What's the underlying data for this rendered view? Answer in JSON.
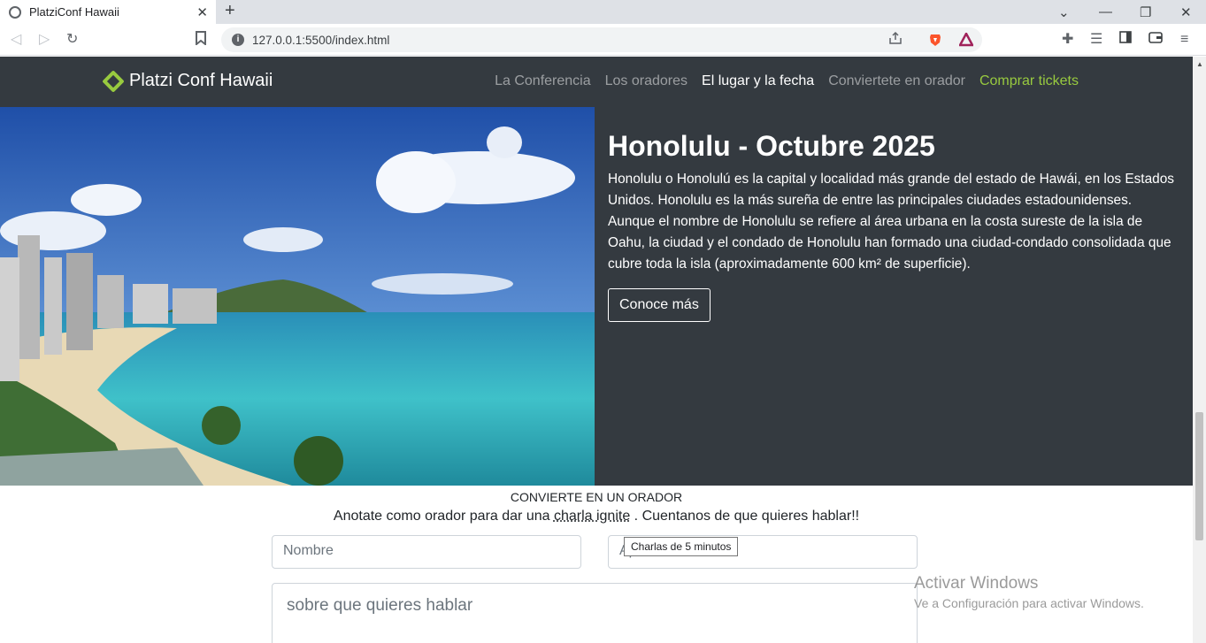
{
  "browser": {
    "tab_title": "PlatziConf Hawaii",
    "url": "127.0.0.1:5500/index.html",
    "new_tab": "+",
    "tab_close": "✕"
  },
  "nav": {
    "brand": "Platzi Conf Hawaii",
    "links": [
      "La Conferencia",
      "Los oradores",
      "El lugar y la fecha",
      "Conviertete en orador",
      "Comprar tickets"
    ],
    "active_index": 2,
    "accent": "#98ca3f"
  },
  "hero": {
    "title": "Honolulu - Octubre 2025",
    "body": "Honolulu o Honolulú es la capital y localidad más grande del estado de Hawái, en los Estados Unidos. Honolulu es la más sureña de entre las principales ciudades estadounidenses. Aunque el nombre de Honolulu se refiere al área urbana en la costa sureste de la isla de Oahu, la ciudad y el condado de Honolulu han formado una ciudad-condado consolidada que cubre toda la isla (aproximadamente 600 km² de superficie).",
    "button": "Conoce más"
  },
  "speaker": {
    "heading": "CONVIERTE EN UN ORADOR",
    "lead_pre": "Anotate como orador para dar una ",
    "lead_abbr": "charla ignite",
    "lead_post": " . Cuentanos de que quieres hablar!!",
    "name_placeholder": "Nombre",
    "last_placeholder": "Apellido",
    "topic_placeholder": "sobre que quieres hablar",
    "tooltip": "Charlas de 5 minutos"
  },
  "watermark": {
    "line1": "Activar Windows",
    "line2": "Ve a Configuración para activar Windows."
  }
}
